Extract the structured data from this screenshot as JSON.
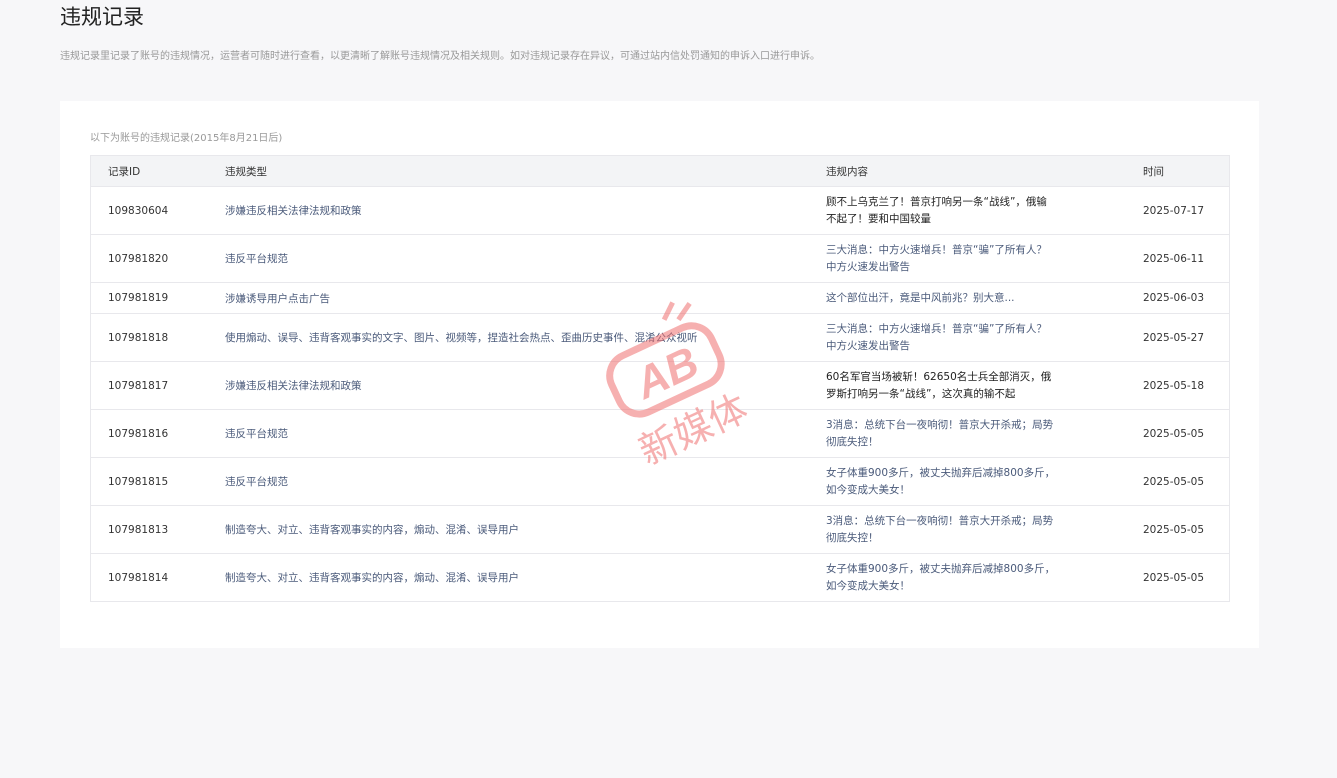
{
  "page": {
    "title": "违规记录",
    "description": "违规记录里记录了账号的违规情况，运营者可随时进行查看，以更清晰了解账号违规情况及相关规则。如对违规记录存在异议，可通过站内信处罚通知的申诉入口进行申诉。"
  },
  "records": {
    "caption": "以下为账号的违规记录(2015年8月21日后)",
    "columns": {
      "id": "记录ID",
      "type": "违规类型",
      "content": "违规内容",
      "time": "时间"
    },
    "rows": [
      {
        "id": "109830604",
        "type": "涉嫌违反相关法律法规和政策",
        "content": "顾不上乌克兰了！普京打响另一条“战线”，俄输不起了！要和中国较量",
        "time": "2025-07-17"
      },
      {
        "id": "107981820",
        "type": "违反平台规范",
        "content": "三大消息：中方火速增兵！普京“骗”了所有人？中方火速发出警告",
        "time": "2025-06-11"
      },
      {
        "id": "107981819",
        "type": "涉嫌诱导用户点击广告",
        "content": "这个部位出汗，竟是中风前兆？别大意...",
        "time": "2025-06-03"
      },
      {
        "id": "107981818",
        "type": "使用煽动、误导、违背客观事实的文字、图片、视频等，捏造社会热点、歪曲历史事件、混淆公众视听",
        "content": "三大消息：中方火速增兵！普京“骗”了所有人？中方火速发出警告",
        "time": "2025-05-27"
      },
      {
        "id": "107981817",
        "type": "涉嫌违反相关法律法规和政策",
        "content": "60名军官当场被斩！62650名士兵全部消灭，俄罗斯打响另一条“战线”，这次真的输不起",
        "time": "2025-05-18"
      },
      {
        "id": "107981816",
        "type": "违反平台规范",
        "content": "3消息：总统下台一夜响彻！普京大开杀戒；局势彻底失控！",
        "time": "2025-05-05"
      },
      {
        "id": "107981815",
        "type": "违反平台规范",
        "content": "女子体重900多斤，被丈夫抛弃后减掉800多斤，如今变成大美女！",
        "time": "2025-05-05"
      },
      {
        "id": "107981813",
        "type": "制造夸大、对立、违背客观事实的内容，煽动、混淆、误导用户",
        "content": "3消息：总统下台一夜响彻！普京大开杀戒；局势彻底失控！",
        "time": "2025-05-05"
      },
      {
        "id": "107981814",
        "type": "制造夸大、对立、违背客观事实的内容，煽动、混淆、误导用户",
        "content": "女子体重900多斤，被丈夫抛弃后减掉800多斤，如今变成大美女！",
        "time": "2025-05-05"
      }
    ]
  },
  "watermark": {
    "logo_text": "AB",
    "sub_text": "新媒体",
    "color": "#f07070"
  },
  "colors": {
    "background": "#f7f7f9",
    "header_bg": "#f3f4f6",
    "link_text": "#4a5a7a",
    "border": "#e8e8ec"
  }
}
